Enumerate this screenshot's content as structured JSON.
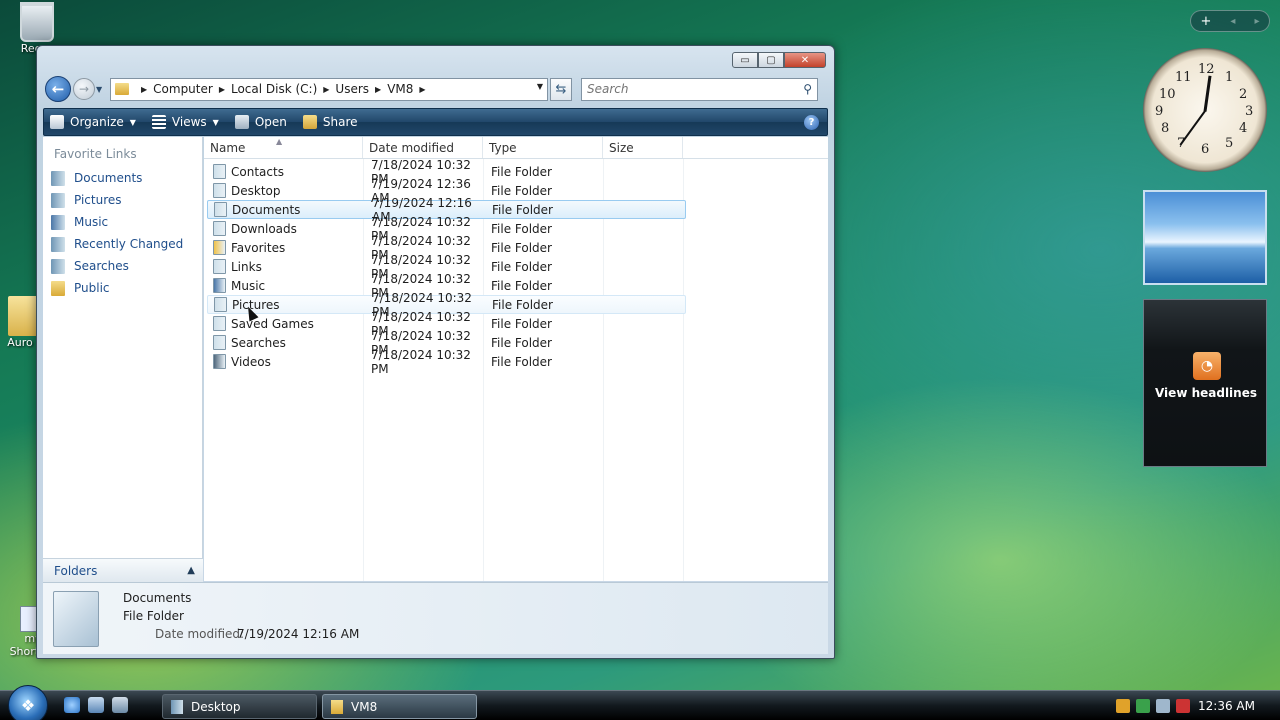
{
  "desktop": {
    "recycle_label": "Recyc",
    "aurora_label": "Auro",
    "shortcut_label_1": "my",
    "shortcut_label_2": "Shortcut"
  },
  "window": {
    "caption": {
      "minimize": "▭",
      "maximize": "▢",
      "close": "✕"
    },
    "breadcrumb": [
      "Computer",
      "Local Disk (C:)",
      "Users",
      "VM8"
    ],
    "search_placeholder": "Search"
  },
  "toolbar": {
    "organize": "Organize",
    "views": "Views",
    "open": "Open",
    "share": "Share",
    "help": "?"
  },
  "nav": {
    "title": "Favorite Links",
    "links": [
      "Documents",
      "Pictures",
      "Music",
      "Recently Changed",
      "Searches",
      "Public"
    ],
    "folders_label": "Folders"
  },
  "columns": {
    "name": "Name",
    "date": "Date modified",
    "type": "Type",
    "size": "Size"
  },
  "files": [
    {
      "name": "Contacts",
      "date": "7/18/2024 10:32 PM",
      "type": "File Folder"
    },
    {
      "name": "Desktop",
      "date": "7/19/2024 12:36 AM",
      "type": "File Folder"
    },
    {
      "name": "Documents",
      "date": "7/19/2024 12:16 AM",
      "type": "File Folder"
    },
    {
      "name": "Downloads",
      "date": "7/18/2024 10:32 PM",
      "type": "File Folder"
    },
    {
      "name": "Favorites",
      "date": "7/18/2024 10:32 PM",
      "type": "File Folder"
    },
    {
      "name": "Links",
      "date": "7/18/2024 10:32 PM",
      "type": "File Folder"
    },
    {
      "name": "Music",
      "date": "7/18/2024 10:32 PM",
      "type": "File Folder"
    },
    {
      "name": "Pictures",
      "date": "7/18/2024 10:32 PM",
      "type": "File Folder"
    },
    {
      "name": "Saved Games",
      "date": "7/18/2024 10:32 PM",
      "type": "File Folder"
    },
    {
      "name": "Searches",
      "date": "7/18/2024 10:32 PM",
      "type": "File Folder"
    },
    {
      "name": "Videos",
      "date": "7/18/2024 10:32 PM",
      "type": "File Folder"
    }
  ],
  "details": {
    "name": "Documents",
    "type": "File Folder",
    "modified_label": "Date modified:",
    "modified_value": "7/19/2024 12:16 AM"
  },
  "sidebar": {
    "add": "+",
    "prev": "◂",
    "next": "▸",
    "clock_numbers": [
      "12",
      "1",
      "2",
      "3",
      "4",
      "5",
      "6",
      "7",
      "8",
      "9",
      "10",
      "11"
    ],
    "feed_label": "View headlines"
  },
  "taskbar": {
    "buttons": [
      "Desktop",
      "VM8"
    ],
    "time": "12:36 AM"
  },
  "colors": {
    "toolbar": "#21476a",
    "link": "#1f4e8b",
    "selection": "#dceefb"
  }
}
